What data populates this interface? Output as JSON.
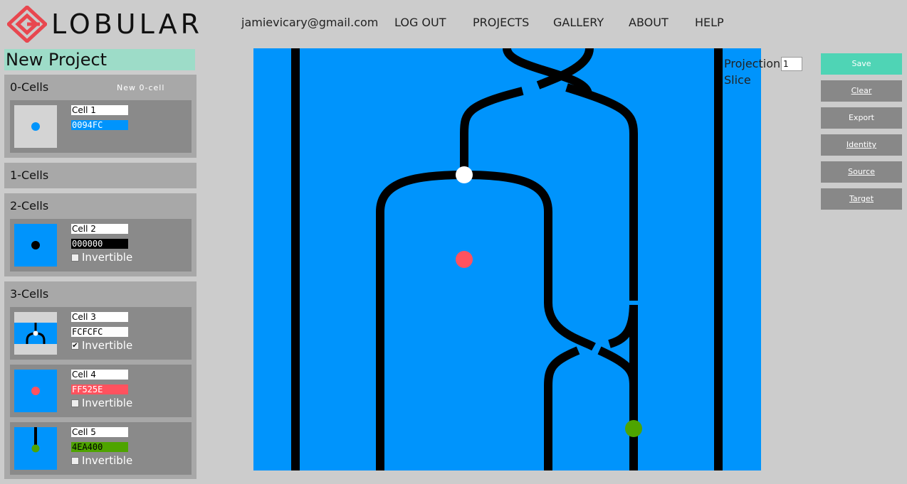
{
  "header": {
    "logo_text": "LOBULAR",
    "email": "jamievicary@gmail.com",
    "nav": {
      "logout": "LOG OUT",
      "projects": "PROJECTS",
      "gallery": "GALLERY",
      "about": "ABOUT",
      "help": "HELP"
    }
  },
  "project": {
    "title": "New Project"
  },
  "groups": {
    "cells0": {
      "title": "0-Cells",
      "new_label": "New 0-cell"
    },
    "cells1": {
      "title": "1-Cells"
    },
    "cells2": {
      "title": "2-Cells"
    },
    "cells3": {
      "title": "3-Cells"
    }
  },
  "cells": {
    "c1": {
      "name": "Cell 1",
      "color": "0094FC"
    },
    "c2": {
      "name": "Cell 2",
      "color": "000000",
      "invertible_label": "Invertible",
      "invertible": false
    },
    "c3": {
      "name": "Cell 3",
      "color": "FCFCFC",
      "invertible_label": "Invertible",
      "invertible": true
    },
    "c4": {
      "name": "Cell 4",
      "color": "FF525E",
      "invertible_label": "Invertible",
      "invertible": false
    },
    "c5": {
      "name": "Cell 5",
      "color": "4EA400",
      "invertible_label": "Invertible",
      "invertible": false
    }
  },
  "view": {
    "projection_label": "Projection",
    "projection_value": "1",
    "slice_label": "Slice"
  },
  "buttons": {
    "save": "Save",
    "clear": "Clear",
    "export": "Export",
    "identity": "Identity",
    "source": "Source",
    "target": "Target"
  },
  "colors": {
    "canvas": "#0094fc",
    "accent": "#4fd4b5",
    "title_bg": "#9ddcc8",
    "wire": "#000000",
    "red_node": "#ff525e",
    "green_node": "#4ea400"
  },
  "icons": [
    "lobular-logo-icon",
    "checkbox-icon"
  ]
}
